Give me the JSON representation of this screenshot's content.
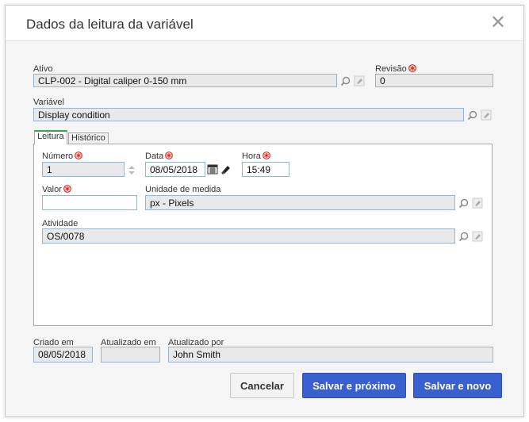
{
  "dialog": {
    "title": "Dados da leitura da variável",
    "close_symbol": "✕"
  },
  "ativo": {
    "label": "Ativo",
    "value": "CLP-002 - Digital caliper 0-150 mm"
  },
  "revisao": {
    "label": "Revisão",
    "value": "0"
  },
  "variavel": {
    "label": "Variável",
    "value": "Display condition"
  },
  "tabs": [
    {
      "label": "Leitura"
    },
    {
      "label": "Histórico"
    }
  ],
  "numero": {
    "label": "Número",
    "value": "1"
  },
  "data": {
    "label": "Data",
    "value": "08/05/2018"
  },
  "hora": {
    "label": "Hora",
    "value": "15:49"
  },
  "valor": {
    "label": "Valor",
    "value": ""
  },
  "unidade": {
    "label": "Unidade de medida",
    "value": "px - Pixels"
  },
  "atividade": {
    "label": "Atividade",
    "value": "OS/0078"
  },
  "criado_em": {
    "label": "Criado em",
    "value": "08/05/2018"
  },
  "atualizado_em": {
    "label": "Atualizado em",
    "value": ""
  },
  "atualizado_por": {
    "label": "Atualizado por",
    "value": "John Smith"
  },
  "buttons": {
    "cancel": "Cancelar",
    "save_next": "Salvar e próximo",
    "save_new": "Salvar e novo"
  },
  "colors": {
    "required": "#e0251b",
    "field_border": "#9bb3c9",
    "primary_button": "#3a5fcf"
  },
  "icons": [
    "close-icon",
    "required-icon",
    "search-icon",
    "clear-icon",
    "calendar-icon",
    "spinner-icon"
  ]
}
